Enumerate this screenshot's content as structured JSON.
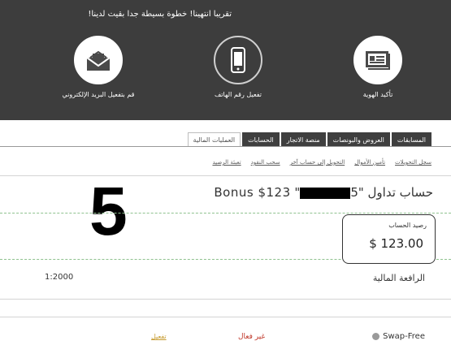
{
  "banner": {
    "message": "تقريبا انتهينا! خطوة بسيطة جدا بقيت لدينا!",
    "steps": [
      {
        "label": "تأكيد الهوية",
        "icon": "id-card-icon"
      },
      {
        "label": "تفعيل رقم الهاتف",
        "icon": "mobile-phone-icon"
      },
      {
        "label": "قم بتفعيل البريد الإلكتروني",
        "icon": "envelope-icon"
      }
    ]
  },
  "tabs": [
    {
      "label": "العمليات المالية",
      "active": true
    },
    {
      "label": "الحسابات",
      "active": false
    },
    {
      "label": "منصة الاتجار",
      "active": false
    },
    {
      "label": "العروض والبونصات",
      "active": false
    },
    {
      "label": "المسابقات",
      "active": false
    }
  ],
  "sublinks": [
    "تعبئة الرصيد",
    "سحب النقود",
    "التحويل إلى حساب آخر",
    "تأمين الأموال",
    "سجل التحويلات"
  ],
  "account": {
    "title": "حساب تداول \"5",
    "title_suffix": "\" Bonus $123",
    "step_number": "5"
  },
  "balance": {
    "label": "رصيد الحساب",
    "value": "$ 123.00"
  },
  "leverage": {
    "label": "الرافعة المالية",
    "value": "1:2000"
  },
  "swap": {
    "label": "Swap-Free",
    "status": "غير فعال",
    "action": "تفعيل"
  },
  "colors": {
    "banner_bg": "#3d3d3d",
    "tab_bg": "#3f3f3f",
    "status_red": "#c0392b",
    "action_gold": "#c69b2e",
    "dashed_green": "#8fc28f"
  }
}
